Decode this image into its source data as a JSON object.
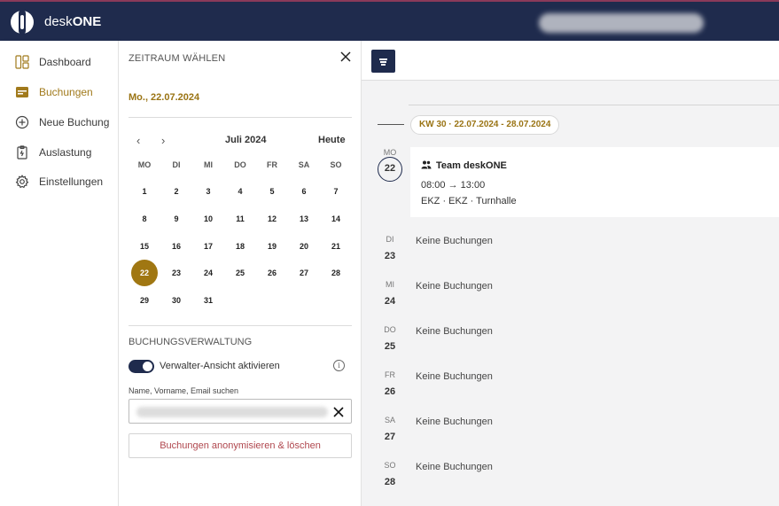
{
  "app": {
    "brand_prefix": "desk",
    "brand_suffix": "ONE"
  },
  "sidebar": {
    "items": [
      {
        "label": "Dashboard",
        "icon": "dashboard-icon"
      },
      {
        "label": "Buchungen",
        "icon": "calendar-icon",
        "active": true
      },
      {
        "label": "Neue Buchung",
        "icon": "plus-circle-icon"
      },
      {
        "label": "Auslastung",
        "icon": "clipboard-icon"
      },
      {
        "label": "Einstellungen",
        "icon": "gear-icon"
      }
    ]
  },
  "panel": {
    "header": "ZEITRAUM WÄHLEN",
    "selected_date": "Mo., 22.07.2024",
    "calendar": {
      "month": "Juli 2024",
      "today_label": "Heute",
      "weekdays": [
        "MO",
        "DI",
        "MI",
        "DO",
        "FR",
        "SA",
        "SO"
      ],
      "weeks": [
        [
          "1",
          "2",
          "3",
          "4",
          "5",
          "6",
          "7"
        ],
        [
          "8",
          "9",
          "10",
          "11",
          "12",
          "13",
          "14"
        ],
        [
          "15",
          "16",
          "17",
          "18",
          "19",
          "20",
          "21"
        ],
        [
          "22",
          "23",
          "24",
          "25",
          "26",
          "27",
          "28"
        ],
        [
          "29",
          "30",
          "31",
          "",
          "",
          "",
          ""
        ]
      ],
      "selected_day": "22"
    },
    "management": {
      "title": "BUCHUNGSVERWALTUNG",
      "toggle_label": "Verwalter-Ansicht aktivieren",
      "toggle_on": true,
      "search_label": "Name, Vorname, Email suchen",
      "anon_button": "Buchungen anonymisieren & löschen"
    }
  },
  "main": {
    "week_label": "KW 30  ·  22.07.2024 - 28.07.2024",
    "days": [
      {
        "abbr": "MO",
        "num": "22",
        "booking": {
          "title": "Team deskONE",
          "time_start": "08:00",
          "time_end": "13:00",
          "location": "EKZ  ·  EKZ  ·  Turnhalle"
        }
      },
      {
        "abbr": "DI",
        "num": "23",
        "text": "Keine Buchungen"
      },
      {
        "abbr": "MI",
        "num": "24",
        "text": "Keine Buchungen"
      },
      {
        "abbr": "DO",
        "num": "25",
        "text": "Keine Buchungen"
      },
      {
        "abbr": "FR",
        "num": "26",
        "text": "Keine Buchungen"
      },
      {
        "abbr": "SA",
        "num": "27",
        "text": "Keine Buchungen"
      },
      {
        "abbr": "SO",
        "num": "28",
        "text": "Keine Buchungen"
      }
    ]
  },
  "colors": {
    "navy": "#1f2b4d",
    "gold": "#a07712",
    "danger_text": "#b0474e"
  }
}
